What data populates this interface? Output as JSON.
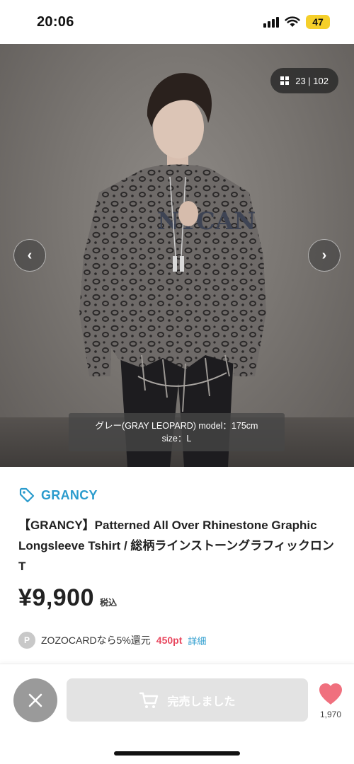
{
  "status_bar": {
    "time": "20:06",
    "battery": "47"
  },
  "image": {
    "counter": "23 | 102",
    "caption_line1": "グレー(GRAY LEOPARD) model：175cm",
    "caption_line2": "size：L",
    "prev_glyph": "‹",
    "next_glyph": "›",
    "shirt_print": "NYCAN"
  },
  "product": {
    "brand": "GRANCY",
    "title": "【GRANCY】Patterned All Over Rhinestone Graphic Longsleeve Tshirt / 総柄ラインストーングラフィックロンT",
    "price": "¥9,900",
    "tax_label": "税込",
    "points_badge": "P",
    "points_text": "ZOZOCARDなら5%還元",
    "points_value": "450pt",
    "points_link": "詳細"
  },
  "actions": {
    "soldout_label": "完売しました",
    "favorite_count": "1,970"
  },
  "colors": {
    "accent": "#2a9bcd",
    "points": "#e8475e",
    "heart": "#f0707e"
  },
  "icons": [
    "signal-icon",
    "wifi-icon",
    "grid-icon",
    "chevron-left-icon",
    "chevron-right-icon",
    "tag-icon",
    "close-icon",
    "cart-icon",
    "heart-icon"
  ]
}
